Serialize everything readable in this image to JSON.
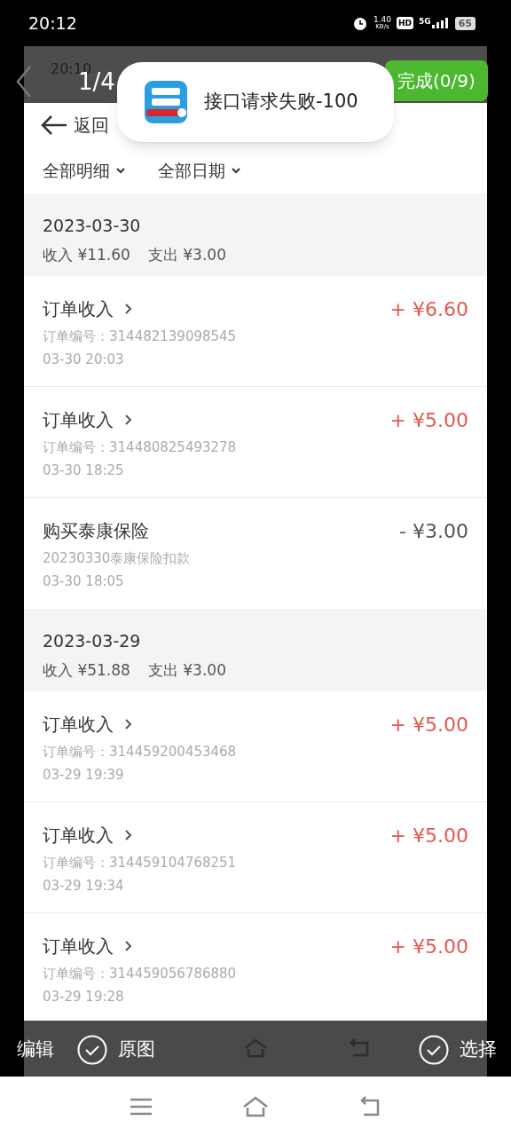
{
  "status_bar": {
    "time": "20:12",
    "net_speed": "1.40",
    "net_unit": "KB/s",
    "hd": "HD",
    "network": "5G",
    "battery": "65"
  },
  "screenshot": {
    "time": "20:10",
    "back": "返回",
    "filters": [
      "全部明细",
      "全部日期"
    ],
    "groups": [
      {
        "date": "2023-03-30",
        "income": "收入 ¥11.60",
        "expense": "支出 ¥3.00",
        "items": [
          {
            "title": "订单收入",
            "link": true,
            "detail": "订单编号：314482139098545",
            "time": "03-30 20:03",
            "amount": "+ ¥6.60",
            "kind": "income"
          },
          {
            "title": "订单收入",
            "link": true,
            "detail": "订单编号：314480825493278",
            "time": "03-30 18:25",
            "amount": "+ ¥5.00",
            "kind": "income"
          },
          {
            "title": "购买泰康保险",
            "link": false,
            "detail": "20230330泰康保险扣款",
            "time": "03-30 18:05",
            "amount": "- ¥3.00",
            "kind": "expense"
          }
        ]
      },
      {
        "date": "2023-03-29",
        "income": "收入 ¥51.88",
        "expense": "支出 ¥3.00",
        "items": [
          {
            "title": "订单收入",
            "link": true,
            "detail": "订单编号：314459200453468",
            "time": "03-29 19:39",
            "amount": "+ ¥5.00",
            "kind": "income"
          },
          {
            "title": "订单收入",
            "link": true,
            "detail": "订单编号：314459104768251",
            "time": "03-29 19:34",
            "amount": "+ ¥5.00",
            "kind": "income"
          },
          {
            "title": "订单收入",
            "link": true,
            "detail": "订单编号：314459056786880",
            "time": "03-29 19:28",
            "amount": "+ ¥5.00",
            "kind": "income"
          }
        ]
      }
    ]
  },
  "viewer": {
    "counter": "1/4",
    "done_button": "完成(0/9)",
    "toolbar": [
      {
        "label": "编辑",
        "kind": "text"
      },
      {
        "label": "原图",
        "kind": "check"
      },
      {
        "label": "选择",
        "kind": "check"
      }
    ]
  },
  "toast": {
    "message": "接口请求失败-100"
  }
}
